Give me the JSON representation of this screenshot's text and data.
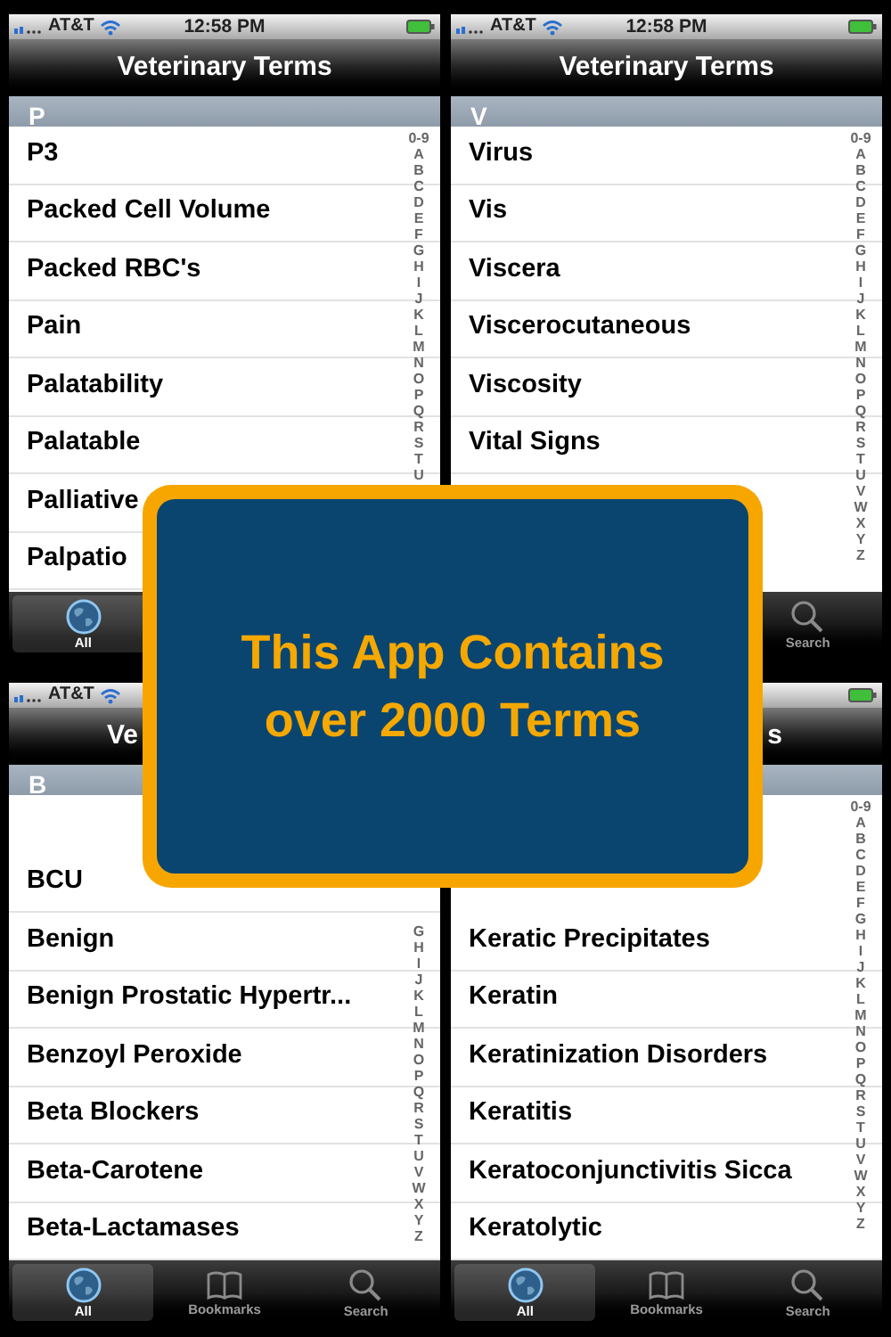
{
  "screens": [
    {
      "status_bar": {
        "carrier": "AT&T",
        "time": "12:58 PM",
        "icons": [
          {
            "kind": "signal"
          },
          {
            "kind": "wifi"
          },
          {
            "kind": "battery"
          }
        ]
      },
      "title": "Veterinary Terms",
      "section": "P",
      "index": [
        "0-9",
        "A",
        "B",
        "C",
        "D",
        "E",
        "F",
        "G",
        "H",
        "I",
        "J",
        "K",
        "L",
        "M",
        "N",
        "O",
        "P",
        "Q",
        "R",
        "S",
        "T",
        "U"
      ],
      "rows": [
        "P3",
        "Packed Cell Volume",
        "Packed RBC's",
        "Pain",
        "Palatability",
        "Palatable",
        "Palliative",
        "Palpatio"
      ],
      "tabs": [
        {
          "label": "All",
          "kind": "globe",
          "selected": true
        }
      ]
    },
    {
      "status_bar": {
        "carrier": "AT&T",
        "time": "12:58 PM",
        "icons": [
          {
            "kind": "signal"
          },
          {
            "kind": "wifi"
          },
          {
            "kind": "battery"
          }
        ]
      },
      "title": "Veterinary Terms",
      "section": "V",
      "index": [
        "0-9",
        "A",
        "B",
        "C",
        "D",
        "E",
        "F",
        "G",
        "H",
        "I",
        "J",
        "K",
        "L",
        "M",
        "N",
        "O",
        "P",
        "Q",
        "R",
        "S",
        "T",
        "U",
        "V",
        "W",
        "X",
        "Y",
        "Z"
      ],
      "rows": [
        "Virus",
        "Vis",
        "Viscera",
        "Viscerocutaneous",
        "Viscosity",
        "Vital Signs"
      ],
      "tabs": [
        {
          "label": "Search",
          "kind": "search",
          "selected": false
        }
      ]
    },
    {
      "status_bar": {
        "carrier": "AT&T",
        "icons": [
          {
            "kind": "signal"
          },
          {
            "kind": "wifi"
          }
        ]
      },
      "title": "Ve",
      "section": "B",
      "index": [
        "G",
        "H",
        "I",
        "J",
        "K",
        "L",
        "M",
        "N",
        "O",
        "P",
        "Q",
        "R",
        "S",
        "T",
        "U",
        "V",
        "W",
        "X",
        "Y",
        "Z"
      ],
      "rows": [
        "BCU",
        "Benign",
        "Benign Prostatic Hypertr...",
        "Benzoyl Peroxide",
        "Beta Blockers",
        "Beta-Carotene",
        "Beta-Lactamases"
      ],
      "tabs": [
        {
          "label": "All",
          "kind": "globe",
          "selected": true
        },
        {
          "label": "Bookmarks",
          "kind": "book",
          "selected": false
        },
        {
          "label": "Search",
          "kind": "search",
          "selected": false
        }
      ]
    },
    {
      "status_bar": {
        "icons": [
          {
            "kind": "battery"
          }
        ]
      },
      "title": "s",
      "index": [
        "0-9",
        "A",
        "B",
        "C",
        "D",
        "E",
        "F",
        "G",
        "H",
        "I",
        "J",
        "K",
        "L",
        "M",
        "N",
        "O",
        "P",
        "Q",
        "R",
        "S",
        "T",
        "U",
        "V",
        "W",
        "X",
        "Y",
        "Z"
      ],
      "rows": [
        "Keratic Precipitates",
        "Keratin",
        "Keratinization Disorders",
        "Keratitis",
        "Keratoconjunctivitis Sicca",
        "Keratolytic"
      ],
      "tabs": [
        {
          "label": "All",
          "kind": "globe",
          "selected": true
        },
        {
          "label": "Bookmarks",
          "kind": "book",
          "selected": false
        },
        {
          "label": "Search",
          "kind": "search",
          "selected": false
        }
      ]
    }
  ],
  "promo_banner": {
    "text": "This App Contains over 2000 Terms"
  }
}
